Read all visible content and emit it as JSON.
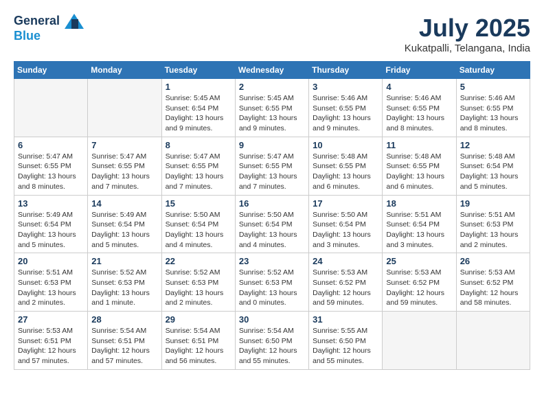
{
  "header": {
    "logo_line1": "General",
    "logo_line2": "Blue",
    "month": "July 2025",
    "location": "Kukatpalli, Telangana, India"
  },
  "days_of_week": [
    "Sunday",
    "Monday",
    "Tuesday",
    "Wednesday",
    "Thursday",
    "Friday",
    "Saturday"
  ],
  "weeks": [
    [
      {
        "day": "",
        "empty": true
      },
      {
        "day": "",
        "empty": true
      },
      {
        "day": "1",
        "sunrise": "Sunrise: 5:45 AM",
        "sunset": "Sunset: 6:54 PM",
        "daylight": "Daylight: 13 hours and 9 minutes."
      },
      {
        "day": "2",
        "sunrise": "Sunrise: 5:45 AM",
        "sunset": "Sunset: 6:55 PM",
        "daylight": "Daylight: 13 hours and 9 minutes."
      },
      {
        "day": "3",
        "sunrise": "Sunrise: 5:46 AM",
        "sunset": "Sunset: 6:55 PM",
        "daylight": "Daylight: 13 hours and 9 minutes."
      },
      {
        "day": "4",
        "sunrise": "Sunrise: 5:46 AM",
        "sunset": "Sunset: 6:55 PM",
        "daylight": "Daylight: 13 hours and 8 minutes."
      },
      {
        "day": "5",
        "sunrise": "Sunrise: 5:46 AM",
        "sunset": "Sunset: 6:55 PM",
        "daylight": "Daylight: 13 hours and 8 minutes."
      }
    ],
    [
      {
        "day": "6",
        "sunrise": "Sunrise: 5:47 AM",
        "sunset": "Sunset: 6:55 PM",
        "daylight": "Daylight: 13 hours and 8 minutes."
      },
      {
        "day": "7",
        "sunrise": "Sunrise: 5:47 AM",
        "sunset": "Sunset: 6:55 PM",
        "daylight": "Daylight: 13 hours and 7 minutes."
      },
      {
        "day": "8",
        "sunrise": "Sunrise: 5:47 AM",
        "sunset": "Sunset: 6:55 PM",
        "daylight": "Daylight: 13 hours and 7 minutes."
      },
      {
        "day": "9",
        "sunrise": "Sunrise: 5:47 AM",
        "sunset": "Sunset: 6:55 PM",
        "daylight": "Daylight: 13 hours and 7 minutes."
      },
      {
        "day": "10",
        "sunrise": "Sunrise: 5:48 AM",
        "sunset": "Sunset: 6:55 PM",
        "daylight": "Daylight: 13 hours and 6 minutes."
      },
      {
        "day": "11",
        "sunrise": "Sunrise: 5:48 AM",
        "sunset": "Sunset: 6:55 PM",
        "daylight": "Daylight: 13 hours and 6 minutes."
      },
      {
        "day": "12",
        "sunrise": "Sunrise: 5:48 AM",
        "sunset": "Sunset: 6:54 PM",
        "daylight": "Daylight: 13 hours and 5 minutes."
      }
    ],
    [
      {
        "day": "13",
        "sunrise": "Sunrise: 5:49 AM",
        "sunset": "Sunset: 6:54 PM",
        "daylight": "Daylight: 13 hours and 5 minutes."
      },
      {
        "day": "14",
        "sunrise": "Sunrise: 5:49 AM",
        "sunset": "Sunset: 6:54 PM",
        "daylight": "Daylight: 13 hours and 5 minutes."
      },
      {
        "day": "15",
        "sunrise": "Sunrise: 5:50 AM",
        "sunset": "Sunset: 6:54 PM",
        "daylight": "Daylight: 13 hours and 4 minutes."
      },
      {
        "day": "16",
        "sunrise": "Sunrise: 5:50 AM",
        "sunset": "Sunset: 6:54 PM",
        "daylight": "Daylight: 13 hours and 4 minutes."
      },
      {
        "day": "17",
        "sunrise": "Sunrise: 5:50 AM",
        "sunset": "Sunset: 6:54 PM",
        "daylight": "Daylight: 13 hours and 3 minutes."
      },
      {
        "day": "18",
        "sunrise": "Sunrise: 5:51 AM",
        "sunset": "Sunset: 6:54 PM",
        "daylight": "Daylight: 13 hours and 3 minutes."
      },
      {
        "day": "19",
        "sunrise": "Sunrise: 5:51 AM",
        "sunset": "Sunset: 6:53 PM",
        "daylight": "Daylight: 13 hours and 2 minutes."
      }
    ],
    [
      {
        "day": "20",
        "sunrise": "Sunrise: 5:51 AM",
        "sunset": "Sunset: 6:53 PM",
        "daylight": "Daylight: 13 hours and 2 minutes."
      },
      {
        "day": "21",
        "sunrise": "Sunrise: 5:52 AM",
        "sunset": "Sunset: 6:53 PM",
        "daylight": "Daylight: 13 hours and 1 minute."
      },
      {
        "day": "22",
        "sunrise": "Sunrise: 5:52 AM",
        "sunset": "Sunset: 6:53 PM",
        "daylight": "Daylight: 13 hours and 2 minutes."
      },
      {
        "day": "23",
        "sunrise": "Sunrise: 5:52 AM",
        "sunset": "Sunset: 6:53 PM",
        "daylight": "Daylight: 13 hours and 0 minutes."
      },
      {
        "day": "24",
        "sunrise": "Sunrise: 5:53 AM",
        "sunset": "Sunset: 6:52 PM",
        "daylight": "Daylight: 12 hours and 59 minutes."
      },
      {
        "day": "25",
        "sunrise": "Sunrise: 5:53 AM",
        "sunset": "Sunset: 6:52 PM",
        "daylight": "Daylight: 12 hours and 59 minutes."
      },
      {
        "day": "26",
        "sunrise": "Sunrise: 5:53 AM",
        "sunset": "Sunset: 6:52 PM",
        "daylight": "Daylight: 12 hours and 58 minutes."
      }
    ],
    [
      {
        "day": "27",
        "sunrise": "Sunrise: 5:53 AM",
        "sunset": "Sunset: 6:51 PM",
        "daylight": "Daylight: 12 hours and 57 minutes."
      },
      {
        "day": "28",
        "sunrise": "Sunrise: 5:54 AM",
        "sunset": "Sunset: 6:51 PM",
        "daylight": "Daylight: 12 hours and 57 minutes."
      },
      {
        "day": "29",
        "sunrise": "Sunrise: 5:54 AM",
        "sunset": "Sunset: 6:51 PM",
        "daylight": "Daylight: 12 hours and 56 minutes."
      },
      {
        "day": "30",
        "sunrise": "Sunrise: 5:54 AM",
        "sunset": "Sunset: 6:50 PM",
        "daylight": "Daylight: 12 hours and 55 minutes."
      },
      {
        "day": "31",
        "sunrise": "Sunrise: 5:55 AM",
        "sunset": "Sunset: 6:50 PM",
        "daylight": "Daylight: 12 hours and 55 minutes."
      },
      {
        "day": "",
        "empty": true
      },
      {
        "day": "",
        "empty": true
      }
    ]
  ]
}
